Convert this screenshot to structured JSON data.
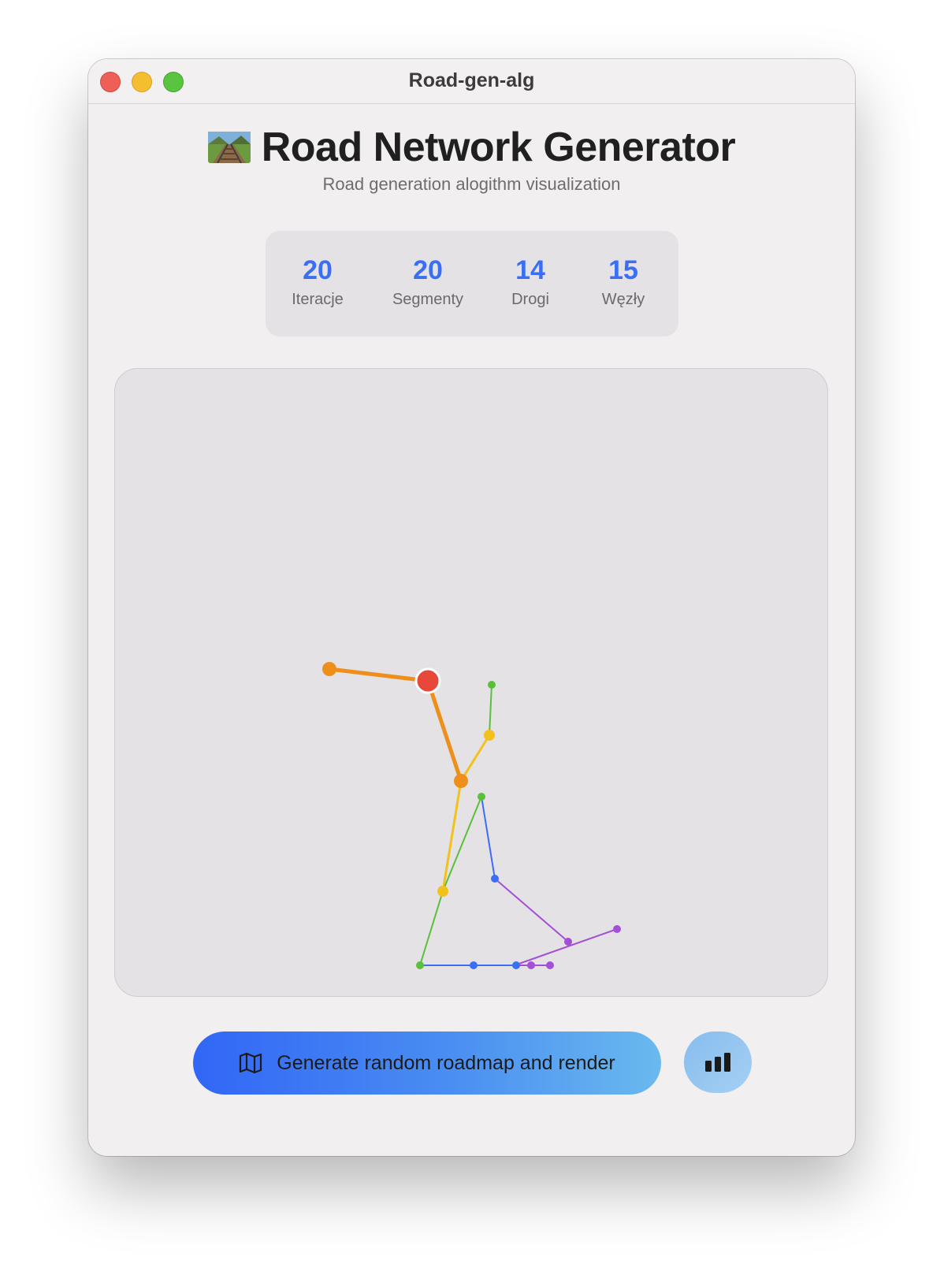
{
  "window": {
    "title": "Road-gen-alg"
  },
  "header": {
    "icon": "railway-track-icon",
    "title": "Road Network Generator",
    "subtitle": "Road generation alogithm visualization"
  },
  "stats": [
    {
      "value": "20",
      "label": "Iteracje"
    },
    {
      "value": "20",
      "label": "Segmenty"
    },
    {
      "value": "14",
      "label": "Drogi"
    },
    {
      "value": "15",
      "label": "Węzły"
    }
  ],
  "colors": {
    "accent": "#3a6ff5",
    "main_road": "#ee8f1c",
    "secondary_road": "#f2c11c",
    "green_road": "#5ac03c",
    "blue_road": "#3a6ff5",
    "purple_road": "#a34fd6",
    "root_node": "#e8483a"
  },
  "actions": {
    "generate_label": "Generate random roadmap and render",
    "generate_icon": "map-icon",
    "stats_icon": "bar-chart-icon"
  }
}
